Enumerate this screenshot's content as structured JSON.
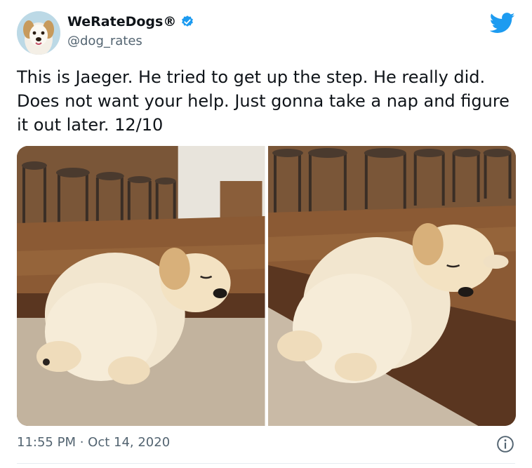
{
  "author": {
    "display_name": "WeRateDogs®",
    "handle": "@dog_rates",
    "verified": true
  },
  "tweet": {
    "text": "This is Jaeger. He tried to get up the step. He really did. Does not want your help. Just gonna take a nap and figure it out later. 12/10",
    "timestamp": "11:55 PM · Oct 14, 2020"
  },
  "media": {
    "photo_count": 2
  },
  "icons": {
    "brand": "twitter-bird-icon",
    "verified": "verified-badge-icon",
    "info": "info-icon"
  },
  "colors": {
    "accent": "#1d9bf0",
    "secondary_text": "#536471",
    "primary_text": "#0f1419"
  }
}
